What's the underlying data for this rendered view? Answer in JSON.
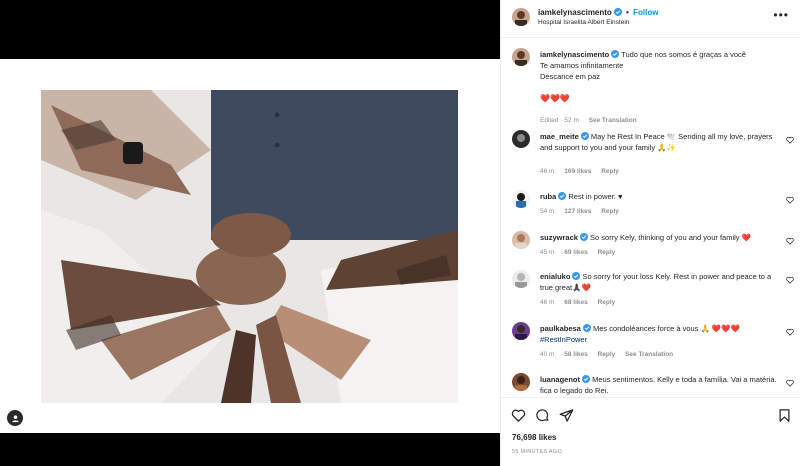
{
  "post": {
    "username": "iamkelynascimento",
    "follow_label": "Follow",
    "separator": "•",
    "location": "Hospital Israelita Albert Einstein",
    "more_label": "•••"
  },
  "caption": {
    "username": "iamkelynascimento",
    "line1": "Tudo que nos somos é graças a você",
    "line2": "Te amamos infinitamente",
    "line3": "Descance em paz",
    "hearts": "❤️❤️❤️",
    "edited": "Edited",
    "time": "52 m",
    "translate": "See Translation"
  },
  "comments": [
    {
      "username": "mae_meite",
      "text": "May he Rest In Peace 🕊️ Sending all my love, prayers and support to you and your family 🙏✨",
      "time": "46 m",
      "likes": "169 likes",
      "reply": "Reply"
    },
    {
      "username": "ruba",
      "text": "Rest in power. ♥",
      "time": "54 m",
      "likes": "127 likes",
      "reply": "Reply"
    },
    {
      "username": "suzywrack",
      "text": "So sorry Kely, thinking of you and your family ❤️",
      "time": "45 m",
      "likes": "69 likes",
      "reply": "Reply"
    },
    {
      "username": "enialuko",
      "text": "So sorry for your loss Kely. Rest in power and peace to a true great🙏🏿❤️",
      "time": "46 m",
      "likes": "68 likes",
      "reply": "Reply"
    },
    {
      "username": "paulkabesa",
      "text": "Mes condoléances force à vous 🙏 ❤️❤️❤️",
      "hashtag": "#RestInPower",
      "time": "40 m",
      "likes": "58 likes",
      "reply": "Reply",
      "translate": "See Translation"
    },
    {
      "username": "luanagenot",
      "text": "Meus sentimentos. Kelly e toda a família. Vai a matéria. fica o legado do Rei."
    }
  ],
  "footer": {
    "likes": "76,698 likes",
    "time": "55 MINUTES AGO"
  },
  "icons": {
    "like": "heart-icon",
    "comment": "comment-icon",
    "share": "share-icon",
    "save": "bookmark-icon",
    "tag": "user-tag-icon",
    "verified": "verified-badge-icon"
  },
  "colors": {
    "accent": "#0095f6",
    "verified": "#3897f0",
    "heart": "#ed4956",
    "muted": "#8e8e8e",
    "text": "#262626"
  }
}
